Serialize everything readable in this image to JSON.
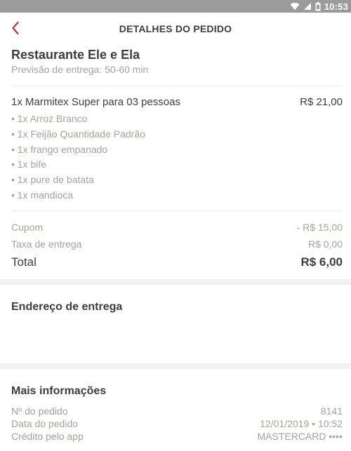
{
  "status_bar": {
    "time": "10:53",
    "icons": [
      "wifi-icon",
      "signal-icon",
      "battery-icon"
    ]
  },
  "header": {
    "title": "DETALHES DO PEDIDO",
    "back_icon": "chevron-left-icon"
  },
  "restaurant": {
    "name": "Restaurante Ele e Ela",
    "eta": "Previsão de entrega: 50-60 min"
  },
  "order_item": {
    "name": "1x Marmitex Super para 03 pessoas",
    "price": "R$ 21,00",
    "subitems": [
      "• 1x Arroz Branco",
      "• 1x Feijão Quantidade Padrão",
      "• 1x frango empanado",
      "• 1x bife",
      "• 1x pure de batata",
      "• 1x mandioca"
    ]
  },
  "summary": {
    "coupon_label": "Cupom",
    "coupon_value": "- R$ 15,00",
    "delivery_label": "Taxa de entrega",
    "delivery_value": "R$ 0,00",
    "total_label": "Total",
    "total_value": "R$ 6,00"
  },
  "delivery_address": {
    "title": "Endereço de entrega"
  },
  "more_info": {
    "title": "Mais informações",
    "order_number_label": "Nº do pedido",
    "order_number_value": "8141",
    "order_date_label": "Data do pedido",
    "order_date_value": "12/01/2019 • 10:52",
    "payment_label": "Crédito pelo app",
    "payment_value": "MASTERCARD ••••"
  },
  "colors": {
    "accent": "#c0303a",
    "status_bar": "#9b9b9b",
    "text": "#3f3e3e",
    "muted": "#a6a29f"
  }
}
